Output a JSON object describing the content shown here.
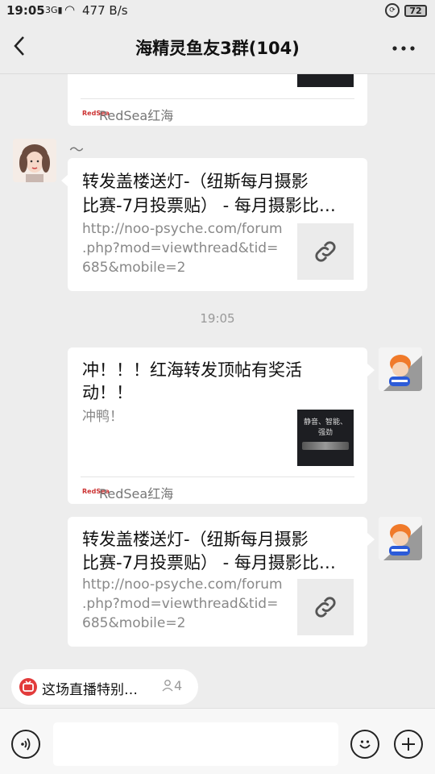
{
  "status_bar": {
    "time": "19:05",
    "network": "3G",
    "speed": "477 B/s",
    "battery": "72"
  },
  "header": {
    "title": "海精灵鱼友3群(104)",
    "back_icon": "chevron-left-icon",
    "more_icon": "more-dots-icon"
  },
  "messages": [
    {
      "side": "left",
      "source": "RedSea红海",
      "source_logo": "RedSea"
    },
    {
      "side": "left",
      "sender_name": "～",
      "title": "转发盖楼送灯-（纽斯每月摄影比赛-7月投票贴） - 每月摄影比…",
      "title_line1": "转发盖楼送灯-（纽斯每月摄影",
      "title_line2": "比赛-7月投票贴） - 每月摄影比…",
      "desc_line1": "http://noo-psyche.com/forum",
      "desc_line2": ".php?mod=viewthread&tid=",
      "desc_line3": "685&mobile=2",
      "icon": "link-icon"
    },
    {
      "timestamp": "19:05"
    },
    {
      "side": "right",
      "title_line1": "冲！！！红海转发顶帖有奖活",
      "title_line2": "动！！",
      "desc": "冲鸭！",
      "thumb_text": "静音、智能、强劲",
      "source": "RedSea红海",
      "source_logo": "RedSea"
    },
    {
      "side": "right",
      "title_line1": "转发盖楼送灯-（纽斯每月摄影",
      "title_line2": "比赛-7月投票贴） - 每月摄影比…",
      "desc_line1": "http://noo-psyche.com/forum",
      "desc_line2": ".php?mod=viewthread&tid=",
      "desc_line3": "685&mobile=2",
      "icon": "link-icon"
    }
  ],
  "live_pill": {
    "text": "这场直播特别…",
    "viewers": "4"
  },
  "input_bar": {
    "voice_icon": "voice-icon",
    "emoji_icon": "emoji-icon",
    "plus_icon": "plus-icon"
  }
}
